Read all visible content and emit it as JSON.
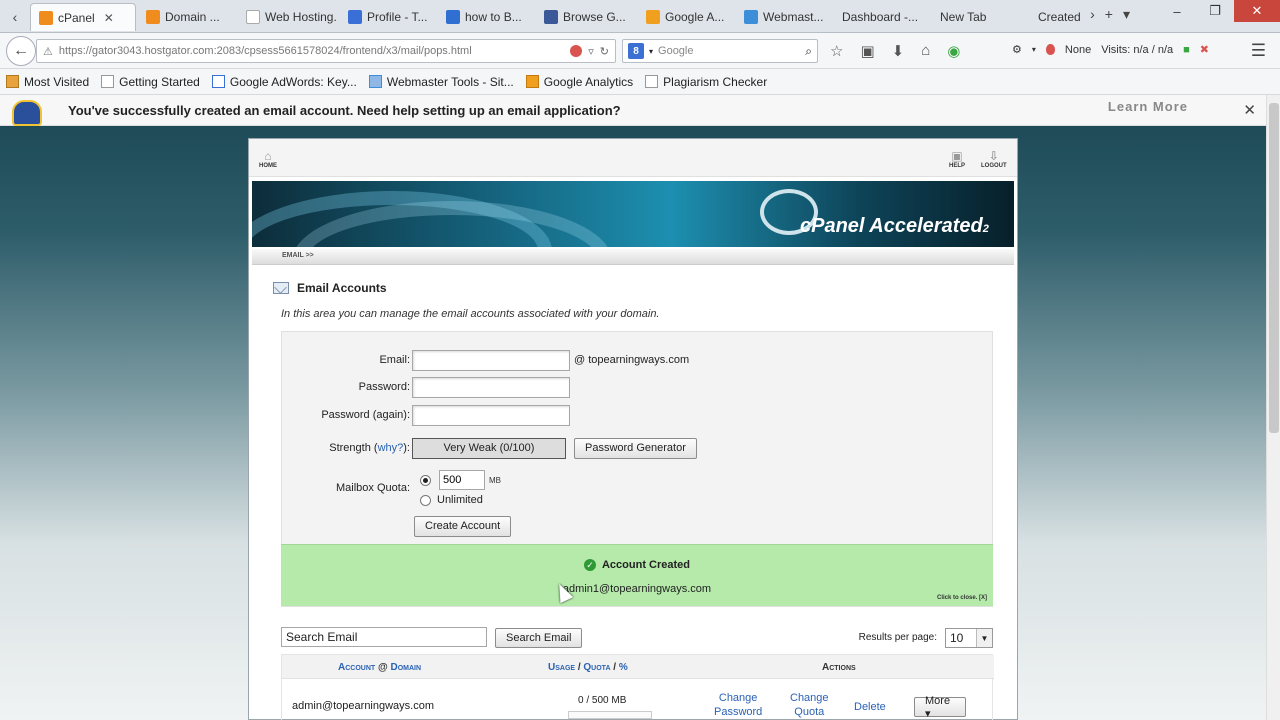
{
  "browser": {
    "tabs": [
      {
        "label": "cPanel",
        "active": true,
        "favicon_color": "#f08c1e"
      },
      {
        "label": "Domain ...",
        "active": false,
        "favicon_color": "#f08c1e"
      },
      {
        "label": "Web Hosting...",
        "active": false,
        "favicon_color": "#ffffff"
      },
      {
        "label": "Profile - T...",
        "active": false,
        "favicon_color": "#3a6fd8"
      },
      {
        "label": "how to B...",
        "active": false,
        "favicon_color": "#2f6fd1"
      },
      {
        "label": "Browse G...",
        "active": false,
        "favicon_color": "#3b5998"
      },
      {
        "label": "Google A...",
        "active": false,
        "favicon_color": "#f0a01e"
      },
      {
        "label": "Webmast...",
        "active": false,
        "favicon_color": "#3c8ed8"
      },
      {
        "label": "Dashboard -...",
        "active": false,
        "favicon_color": "#ffffff"
      },
      {
        "label": "New Tab",
        "active": false,
        "favicon_color": "#ffffff"
      },
      {
        "label": "Created",
        "active": false,
        "favicon_color": "#ffffff"
      }
    ],
    "url": "https://gator3043.hostgator.com:2083/cpsess5661578024/frontend/x3/mail/pops.html",
    "search_placeholder": "Google",
    "search_engine_badge": "8",
    "status_none": "None",
    "status_visits": "Visits: n/a / n/a",
    "bookmarks": [
      "Most Visited",
      "Getting Started",
      "Google AdWords: Key...",
      "Webmaster Tools - Sit...",
      "Google Analytics",
      "Plagiarism Checker"
    ]
  },
  "notification": {
    "text": "You've successfully created an email account. Need help setting up an email application?",
    "learn_more": "Learn More"
  },
  "cpanel": {
    "top_left": "HOME",
    "top_help": "HELP",
    "top_logout": "LOGOUT",
    "brand": "cPanel Accelerated",
    "brand_sub": "2",
    "breadcrumb": "EMAIL >>",
    "section_title": "Email Accounts",
    "section_desc": "In this area you can manage the email accounts associated with your domain.",
    "form": {
      "email_label": "Email:",
      "email_value": "",
      "domain_suffix": "@ topearningways.com",
      "password_label": "Password:",
      "password_again_label": "Password (again):",
      "strength_label": "Strength",
      "why_link": "why?",
      "strength_value": "Very Weak (0/100)",
      "password_generator": "Password Generator",
      "quota_label": "Mailbox Quota:",
      "quota_value": "500",
      "quota_unit": "MB",
      "unlimited_label": "Unlimited",
      "create_button": "Create Account"
    },
    "success": {
      "title": "Account Created",
      "email": "admin1@topearningways.com",
      "close_hint": "Click to close. [X]"
    },
    "list": {
      "search_placeholder": "Search Email",
      "search_button": "Search Email",
      "results_label": "Results per page:",
      "results_value": "10",
      "col_account": "Account",
      "col_at": "@",
      "col_domain": "Domain",
      "col_usage": "Usage",
      "col_quota": "Quota",
      "col_pct": "%",
      "col_actions": "Actions",
      "row_email": "admin@topearningways.com",
      "row_usage": "0 / 500 MB",
      "change_password": "Change\nPassword",
      "change_quota": "Change\nQuota",
      "delete": "Delete",
      "more": "More ▾"
    }
  }
}
